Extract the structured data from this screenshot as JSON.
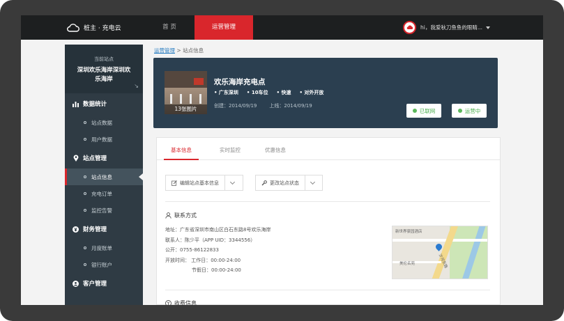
{
  "topbar": {
    "brand": "桩主 · 充电云",
    "nav": [
      "首 页",
      "运营管理"
    ],
    "user": "hi，我爱秋刀鱼鱼的眼睛..."
  },
  "sidebar": {
    "station_caption": "当前站点",
    "station_name": "深圳欢乐海岸深圳欢乐海岸",
    "sections": [
      {
        "label": "数据统计",
        "items": [
          "站点数据",
          "用户数据"
        ]
      },
      {
        "label": "站点管理",
        "items": [
          "站点信息",
          "充电订单",
          "监控告警"
        ]
      },
      {
        "label": "财务管理",
        "items": [
          "月度账单",
          "银行账户"
        ]
      },
      {
        "label": "客户管理",
        "items": []
      }
    ]
  },
  "breadcrumb": {
    "link": "运营管理",
    "sep": ">",
    "current": "站点信息"
  },
  "hero": {
    "photo_caption": "13张图片",
    "title": "欢乐海岸充电点",
    "tags": [
      "• 广东深圳",
      "• 10车位",
      "• 快速",
      "• 对外开放"
    ],
    "created": "创建：2014/09/19",
    "online": "上线：2014/09/19",
    "status_network": "已联网",
    "status_operating": "运营中"
  },
  "tabs": [
    "基本信息",
    "实时监控",
    "优惠信息"
  ],
  "actions": {
    "edit": "编辑站点基本信息",
    "change_state": "更改站点状态"
  },
  "contact": {
    "title": "联系方式",
    "address": "地址：广东省深圳市南山区白石东路8号欢乐海岸",
    "person": "联系人：陈少平（APP UID：3344556）",
    "phone": "公开：0755-86122833",
    "hours_work": "开放时间： 工作日：00:00-24:00",
    "hours_holiday": "节假日：00:00-24:00"
  },
  "map": {
    "label1": "新世界豪园酒店",
    "label2": "美伦名苑",
    "label3": "沙河东路"
  },
  "charging": {
    "title": "收费信息"
  }
}
